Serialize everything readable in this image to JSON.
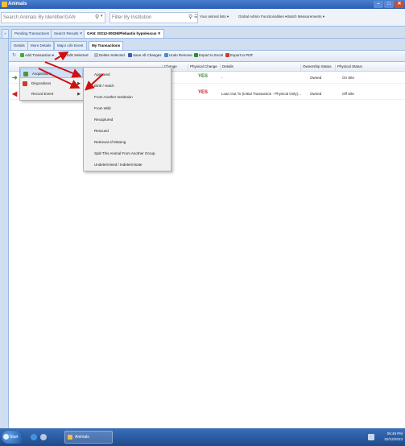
{
  "window": {
    "title": "Animals",
    "buttons": [
      "–",
      "□",
      "✕"
    ]
  },
  "search": {
    "animals_placeholder": "Search Animals By Identifier/GAN",
    "institution_placeholder": "Filter By Institution",
    "links": [
      "Your animal lists ▾",
      "Global Admin Functionalities ▾",
      "Batch Measurements ▾"
    ]
  },
  "tabs": [
    {
      "label": "Pending Transactions"
    },
    {
      "label": "Search Results ✕"
    },
    {
      "label": "GAN: ISS12-00026/Plebaotis hypoleucus ✕"
    }
  ],
  "subtabs": [
    {
      "label": "Details"
    },
    {
      "label": "More Details"
    },
    {
      "label": "Major Life Event"
    },
    {
      "label": "My Transactions"
    }
  ],
  "toolbar": {
    "add": "Add Transaction ▾",
    "edit": "Edit Selected",
    "delete": "Delete Selected",
    "save_all": "Save All Changes",
    "undo": "Undo Remove",
    "excel": "Export to Excel",
    "pdf": "Export to PDF"
  },
  "grid": {
    "headers": [
      "Change",
      "Physical Change",
      "Details",
      "Ownership Status",
      "Physical Status"
    ],
    "rows": [
      {
        "change": "YES",
        "details": "-",
        "ownership": "Owned",
        "physical": "On Site",
        "arrow": "➜",
        "arrow_color": "#3a9a2a",
        "yes_color": "#2e8b2e"
      },
      {
        "change": "YES",
        "details": "Loan Out To (Initial Transaction - Physical Only)...",
        "ownership": "Owned",
        "physical": "Off Site",
        "arrow": "◀",
        "arrow_color": "#cc2222",
        "yes_color": "#c02020"
      }
    ]
  },
  "menu1": {
    "items": [
      {
        "label": "Acquisitions",
        "color": "#4a9a3a"
      },
      {
        "label": "Dispositions",
        "color": "#c83a2a"
      },
      {
        "label": "Record Event",
        "color": "#f0f0f0"
      }
    ],
    "submenu_marker": "▶"
  },
  "menu2": {
    "items": [
      "Appeared",
      "Birth / Hatch",
      "From Another Institution",
      "From Wild",
      "Recaptured",
      "Rescued",
      "Retrieval of Missing",
      "Split This Animal From Another Group",
      "Undetermined / Indeterminate"
    ]
  },
  "taskbar": {
    "start_label": "Start",
    "app_label": "Animals",
    "time": "05:49 PM",
    "date": "02/12/2013"
  }
}
